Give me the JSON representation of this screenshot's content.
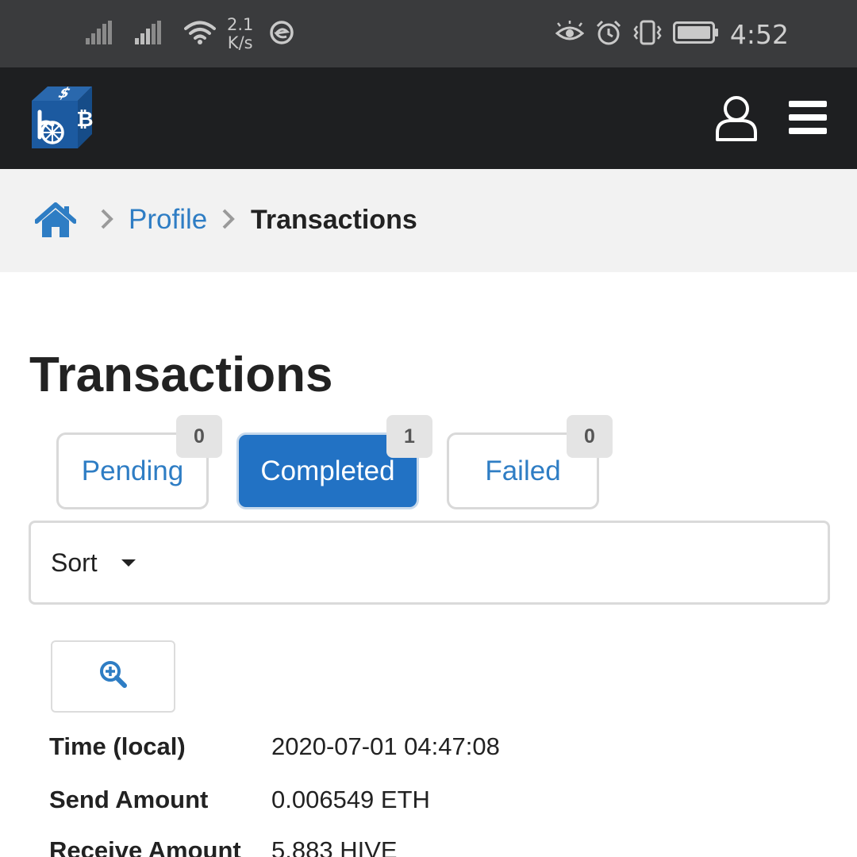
{
  "status_bar": {
    "net_speed_value": "2.1",
    "net_speed_unit": "K/s",
    "time": "4:52",
    "icons": [
      "signal-icon",
      "signal-icon",
      "wifi-icon",
      "data-saver-icon",
      "eye-comfort-icon",
      "alarm-icon",
      "vibrate-icon",
      "battery-icon"
    ]
  },
  "navbar": {
    "icons": [
      "bitcoin-bitshares-logo",
      "user-icon",
      "hamburger-menu-icon"
    ],
    "brand_color": "#1c5aa0"
  },
  "breadcrumb": {
    "icons": [
      "home-icon",
      "chevron-right-icon"
    ],
    "profile": "Profile",
    "current": "Transactions"
  },
  "page": {
    "title": "Transactions"
  },
  "tabs": [
    {
      "label": "Pending",
      "count": "0",
      "active": false
    },
    {
      "label": "Completed",
      "count": "1",
      "active": true
    },
    {
      "label": "Failed",
      "count": "0",
      "active": false
    }
  ],
  "sort": {
    "label": "Sort",
    "icon": "caret-down-icon"
  },
  "transaction": {
    "details_icon": "zoom-in-icon",
    "rows": [
      {
        "label": "Time (local)",
        "value": "2020-07-01 04:47:08"
      },
      {
        "label": "Send Amount",
        "value": "0.006549 ETH"
      },
      {
        "label": "Receive Amount",
        "value": "5.883 HIVE"
      }
    ]
  },
  "colors": {
    "accent": "#2272c4",
    "link": "#2e7dc4",
    "status_bar_bg": "#3a3b3d",
    "navbar_bg": "#1e1f21",
    "breadcrumb_bg": "#f2f2f2"
  }
}
